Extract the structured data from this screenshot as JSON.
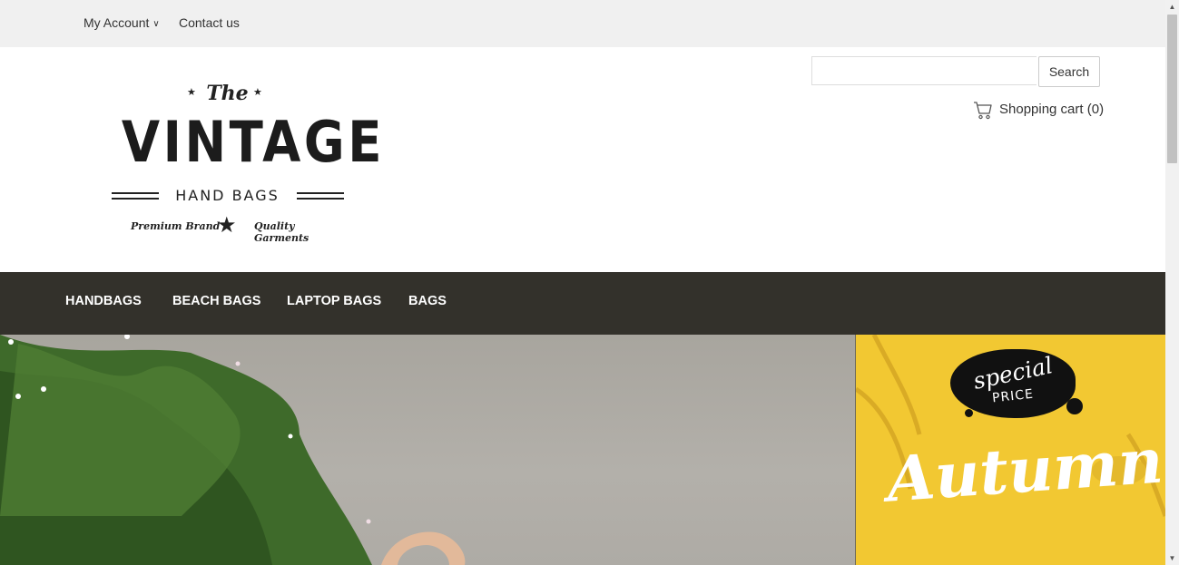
{
  "topbar": {
    "my_account": "My Account",
    "contact_us": "Contact us"
  },
  "logo": {
    "the": "The",
    "vintage": "VINTAGE",
    "hand_bags": "HAND BAGS",
    "premium_brand": "Premium Brand",
    "quality_garments": "Quality Garments"
  },
  "search": {
    "value": "",
    "button_label": "Search"
  },
  "cart": {
    "label": "Shopping cart (0)"
  },
  "nav": {
    "items": [
      "HANDBAGS",
      "BEACH BAGS",
      "LAPTOP BAGS",
      "BAGS"
    ]
  },
  "promo": {
    "special": "special",
    "price": "PRICE",
    "autumn": "Autumn"
  },
  "colors": {
    "topbar_bg": "#f0f0f0",
    "nav_bg": "#33312b",
    "promo_bg": "#f2c832"
  }
}
